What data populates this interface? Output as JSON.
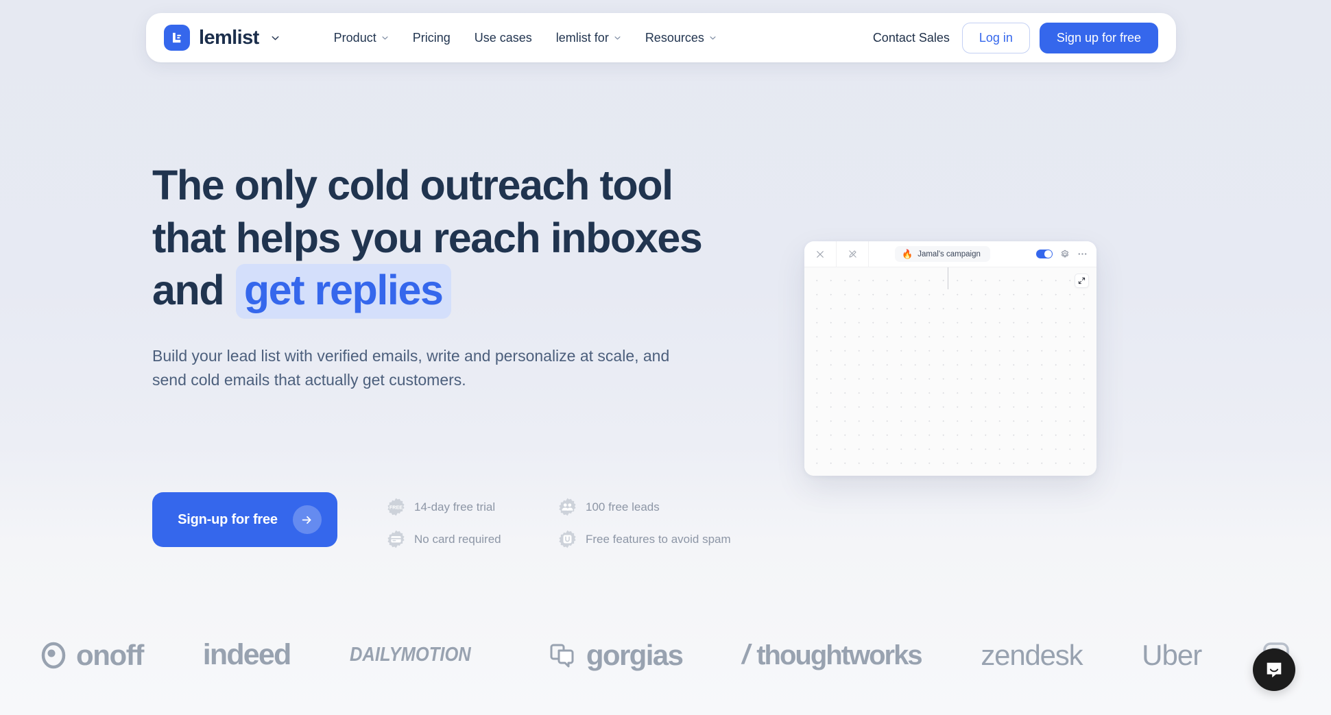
{
  "nav": {
    "brand": "lemlist",
    "brand_caret_icon": "chevron-down-icon",
    "logo_icon": "lemlist-logo-icon",
    "links": [
      {
        "label": "Product",
        "has_caret": true
      },
      {
        "label": "Pricing",
        "has_caret": false
      },
      {
        "label": "Use cases",
        "has_caret": false
      },
      {
        "label": "lemlist for",
        "has_caret": true
      },
      {
        "label": "Resources",
        "has_caret": true
      }
    ],
    "contact_sales": "Contact Sales",
    "login": "Log in",
    "signup": "Sign up for free"
  },
  "hero": {
    "headline_part1": "The only cold outreach tool that helps you reach inboxes and",
    "headline_accent": "get replies",
    "subheadline": "Build your lead list with verified emails, write and personalize at scale, and send cold emails that actually get customers.",
    "cta_label": "Sign-up for free",
    "cta_arrow_icon": "arrow-right-icon",
    "perks": [
      {
        "label": "14-day free trial",
        "icon": "free-badge-icon"
      },
      {
        "label": "100 free leads",
        "icon": "people-badge-icon"
      },
      {
        "label": "No card required",
        "icon": "credit-card-badge-icon"
      },
      {
        "label": "Free features to avoid spam",
        "icon": "unsubscribe-badge-icon"
      }
    ]
  },
  "app_panel": {
    "close_icon": "close-icon",
    "edit_icon": "edit-pen-icon",
    "campaign_flame": "🔥",
    "campaign_name": "Jamal's campaign",
    "toggle_state": "on",
    "settings_icon": "gear-icon",
    "more_icon": "more-horizontal-icon",
    "expand_icon": "expand-arrows-icon"
  },
  "logo_bar": {
    "logos": [
      {
        "id": "onoff",
        "text": "onoff"
      },
      {
        "id": "indeed",
        "text": "indeed"
      },
      {
        "id": "dailymotion",
        "text": "DAILYMOTION"
      },
      {
        "id": "gorgias",
        "text": "gorgias"
      },
      {
        "id": "thoughtworks",
        "text": "thoughtworks",
        "prefix": "/"
      },
      {
        "id": "zendesk",
        "text": "zendesk"
      },
      {
        "id": "uber",
        "text": "Uber"
      }
    ]
  },
  "widgets": {
    "intercom_icon": "chat-bubble-icon"
  },
  "colors": {
    "accent": "#3567ec",
    "headline": "#20344f",
    "highlight_bg": "#d4dffb",
    "muted": "#98a2b0",
    "page_bg": "#e7eaf3"
  }
}
